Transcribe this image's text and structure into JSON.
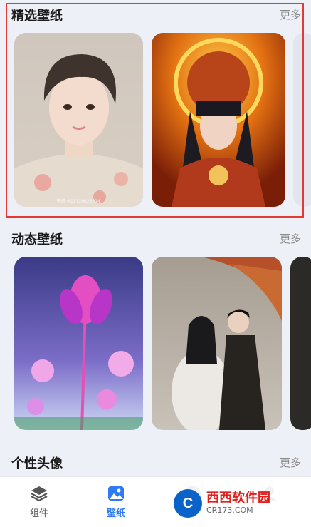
{
  "sections": [
    {
      "title": "精选壁纸",
      "more": "更多"
    },
    {
      "title": "动态壁纸",
      "more": "更多"
    },
    {
      "title": "个性头像",
      "more": "更多"
    }
  ],
  "cards": {
    "featured_1": {
      "caption": "壁纸 #11720023014"
    }
  },
  "tabbar": {
    "tabs": [
      {
        "label": "组件",
        "icon": "layers-icon",
        "active": false
      },
      {
        "label": "壁纸",
        "icon": "image-icon",
        "active": true
      },
      {
        "label": "",
        "icon": "avatar-icon",
        "active": false
      },
      {
        "label": "",
        "icon": "profile-icon",
        "active": false
      }
    ],
    "active_color": "#2f7bf5",
    "inactive_color": "#555555"
  },
  "watermark": {
    "logo": "C",
    "main": "西西软件园",
    "sub": "CR173.COM"
  },
  "colors": {
    "background": "#eef0f8",
    "highlight": "#e53935"
  }
}
